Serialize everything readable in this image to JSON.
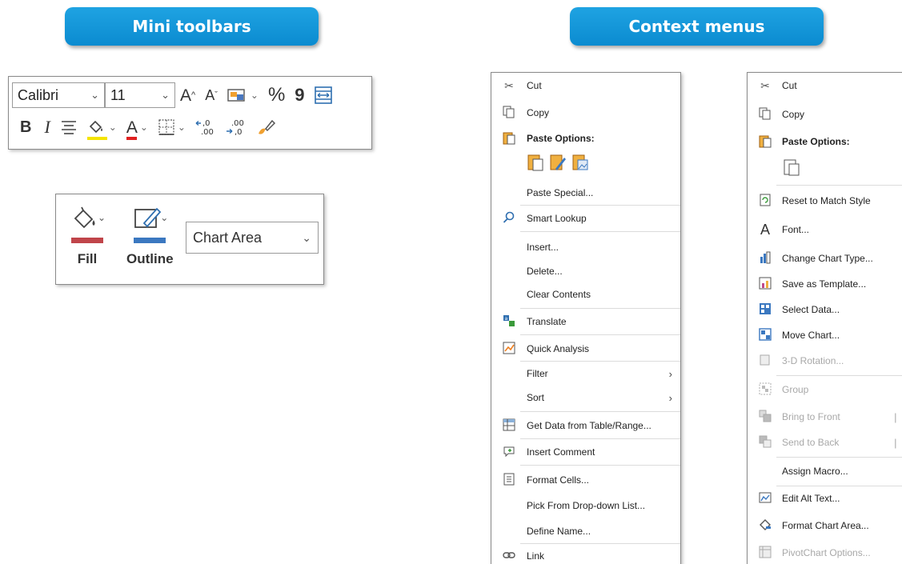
{
  "headings": {
    "mini_toolbars": "Mini toolbars",
    "context_menus": "Context menus"
  },
  "toolbar_cell": {
    "font_name": "Calibri",
    "font_size": "11",
    "icons_row1": [
      "increase-font-size-icon",
      "decrease-font-size-icon",
      "cell-styles-icon",
      "percent-style-icon",
      "comma-style-icon",
      "merge-center-icon"
    ],
    "icons_row2": [
      "bold-icon",
      "italic-icon",
      "align-center-icon",
      "fill-color-icon",
      "font-color-icon",
      "borders-icon",
      "increase-decimal-icon",
      "decrease-decimal-icon",
      "format-painter-icon"
    ],
    "bold_glyph": "B",
    "italic_glyph": "I",
    "font_color_glyph": "A",
    "percent_glyph": "%",
    "comma_glyph": "9",
    "fill_color": "#f5e400",
    "font_color": "#e02020"
  },
  "toolbar_chart": {
    "fill_label": "Fill",
    "outline_label": "Outline",
    "element_value": "Chart Area",
    "fill_color": "#c0454a",
    "outline_color": "#3b78c0"
  },
  "menu_cells": {
    "cut": "Cut",
    "copy": "Copy",
    "paste_options": "Paste Options:",
    "paste_special": "Paste Special...",
    "smart_lookup": "Smart Lookup",
    "insert": "Insert...",
    "delete": "Delete...",
    "clear_contents": "Clear Contents",
    "translate": "Translate",
    "quick_analysis": "Quick Analysis",
    "filter": "Filter",
    "sort": "Sort",
    "get_data": "Get Data from Table/Range...",
    "insert_comment": "Insert Comment",
    "format_cells": "Format Cells...",
    "pick_list": "Pick From Drop-down List...",
    "define_name": "Define Name...",
    "link": "Link"
  },
  "menu_chart": {
    "cut": "Cut",
    "copy": "Copy",
    "paste_options": "Paste Options:",
    "reset_style": "Reset to Match Style",
    "font": "Font...",
    "change_type": "Change Chart Type...",
    "save_template": "Save as Template...",
    "select_data": "Select Data...",
    "move_chart": "Move Chart...",
    "rotation": "3-D Rotation...",
    "group": "Group",
    "bring_front": "Bring to Front",
    "send_back": "Send to Back",
    "assign_macro": "Assign Macro...",
    "alt_text": "Edit Alt Text...",
    "format_area": "Format Chart Area...",
    "pivot_options": "PivotChart Options..."
  }
}
